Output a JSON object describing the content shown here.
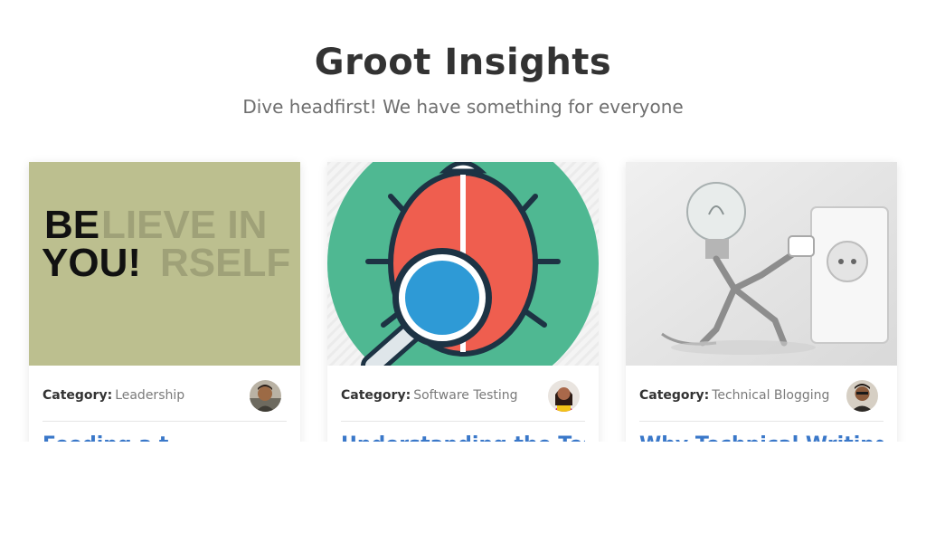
{
  "header": {
    "title": "Groot Insights",
    "subtitle": "Dive headfirst! We have something for everyone"
  },
  "category_label": "Category:",
  "cards": [
    {
      "category": "Leadership",
      "title": "Feeding a t",
      "image_text_bold": [
        "BE",
        "YOU!"
      ],
      "image_text_faded": [
        "LIEVE IN",
        "RSELF"
      ],
      "image_bg": "#bcbf8f"
    },
    {
      "category": "Software Testing",
      "title": "Understanding the Testin",
      "image_bg": "#4fb892"
    },
    {
      "category": "Technical Blogging",
      "title": "Why Technical Writing",
      "image_bg": "#e6e6e6"
    }
  ],
  "colors": {
    "title": "#333333",
    "subtitle": "#6f6f6f",
    "link": "#3a78c9"
  }
}
